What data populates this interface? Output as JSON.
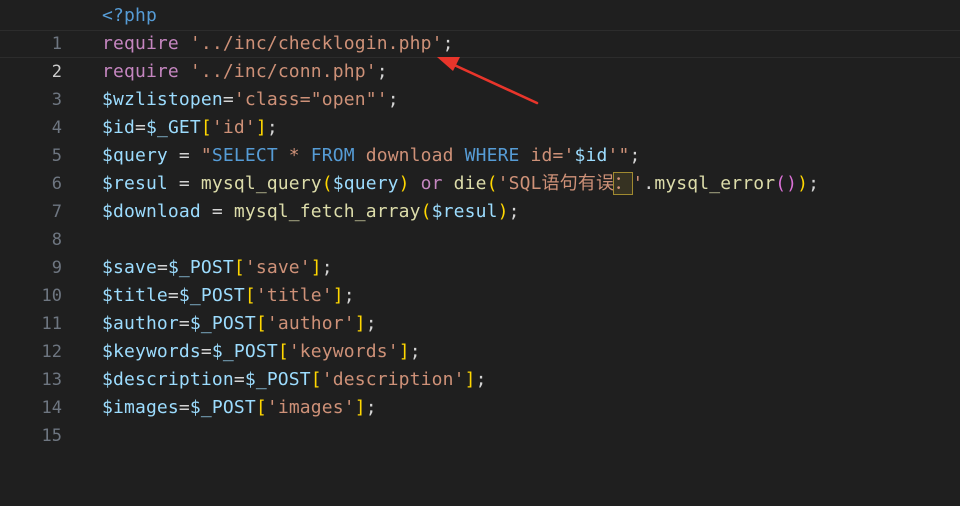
{
  "editor": {
    "lines": [
      {
        "n": "1",
        "t": [
          "<?php"
        ]
      },
      {
        "n": "2",
        "t": [
          "require",
          " ",
          "'../inc/checklogin.php'",
          ";"
        ]
      },
      {
        "n": "3",
        "t": [
          "require",
          " ",
          "'../inc/conn.php'",
          ";"
        ]
      },
      {
        "n": "4",
        "t": [
          "$wzlistopen",
          "=",
          "'class=\"open\"'",
          ";"
        ]
      },
      {
        "n": "5",
        "t": [
          "$id",
          "=",
          "$_GET",
          "[",
          "'id'",
          "]",
          ";"
        ]
      },
      {
        "n": "6",
        "t": [
          "$query",
          " = ",
          "\"",
          "SELECT",
          " * ",
          "FROM",
          " download ",
          "WHERE",
          " id",
          "='",
          "$id",
          "'\"",
          ";"
        ]
      },
      {
        "n": "7",
        "t": [
          "$resul",
          " = ",
          "mysql_query",
          "(",
          "$query",
          ") ",
          "or",
          " ",
          "die",
          "(",
          "'SQL语句有误",
          "：",
          "'",
          ".",
          "mysql_error",
          "()",
          ")",
          ";"
        ]
      },
      {
        "n": "8",
        "t": [
          "$download",
          " = ",
          "mysql_fetch_array",
          "(",
          "$resul",
          ")",
          ";"
        ]
      },
      {
        "n": "9",
        "t": [
          ""
        ]
      },
      {
        "n": "10",
        "t": [
          "$save",
          "=",
          "$_POST",
          "[",
          "'save'",
          "]",
          ";"
        ]
      },
      {
        "n": "11",
        "t": [
          "$title",
          "=",
          "$_POST",
          "[",
          "'title'",
          "]",
          ";"
        ]
      },
      {
        "n": "12",
        "t": [
          "$author",
          "=",
          "$_POST",
          "[",
          "'author'",
          "]",
          ";"
        ]
      },
      {
        "n": "13",
        "t": [
          "$keywords",
          "=",
          "$_POST",
          "[",
          "'keywords'",
          "]",
          ";"
        ]
      },
      {
        "n": "14",
        "t": [
          "$description",
          "=",
          "$_POST",
          "[",
          "'description'",
          "]",
          ";"
        ]
      },
      {
        "n": "15",
        "t": [
          "$images",
          "=",
          "$_POST",
          "[",
          "'images'",
          "]",
          ";"
        ]
      }
    ]
  },
  "colors": {
    "background": "#1f1f1f",
    "annotation_arrow": "#e8352b"
  }
}
